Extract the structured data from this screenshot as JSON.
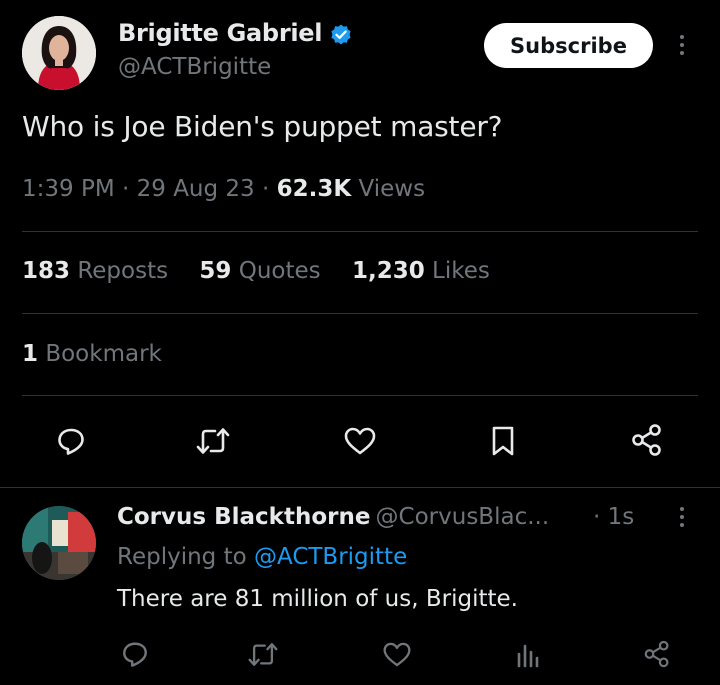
{
  "tweet": {
    "author_name": "Brigitte Gabriel",
    "author_handle": "@ACTBrigitte",
    "verified": true,
    "subscribe_label": "Subscribe",
    "text": "Who is Joe Biden's puppet master?",
    "time": "1:39 PM",
    "date": "29 Aug 23",
    "separator": "·",
    "views_count": "62.3K",
    "views_label": "Views",
    "reposts_count": "183",
    "reposts_label": "Reposts",
    "quotes_count": "59",
    "quotes_label": "Quotes",
    "likes_count": "1,230",
    "likes_label": "Likes",
    "bookmarks_count": "1",
    "bookmarks_label": "Bookmark",
    "actions": [
      "reply-icon",
      "repost-icon",
      "like-icon",
      "bookmark-icon",
      "share-icon"
    ]
  },
  "reply": {
    "author_name": "Corvus Blackthorne",
    "author_handle": "@CorvusBlac...",
    "time": "1s",
    "separator": "·",
    "replying_prefix": "Replying to",
    "replying_handle": "@ACTBrigitte",
    "text": "There are 81 million of us, Brigitte.",
    "actions": [
      "reply-icon",
      "repost-icon",
      "like-icon",
      "analytics-icon",
      "share-icon"
    ]
  },
  "colors": {
    "background": "#000000",
    "text_primary": "#e7e9ea",
    "text_secondary": "#71767b",
    "link": "#1d9bf0",
    "verified_badge": "#1d9bf0",
    "divider": "#2f3336"
  }
}
